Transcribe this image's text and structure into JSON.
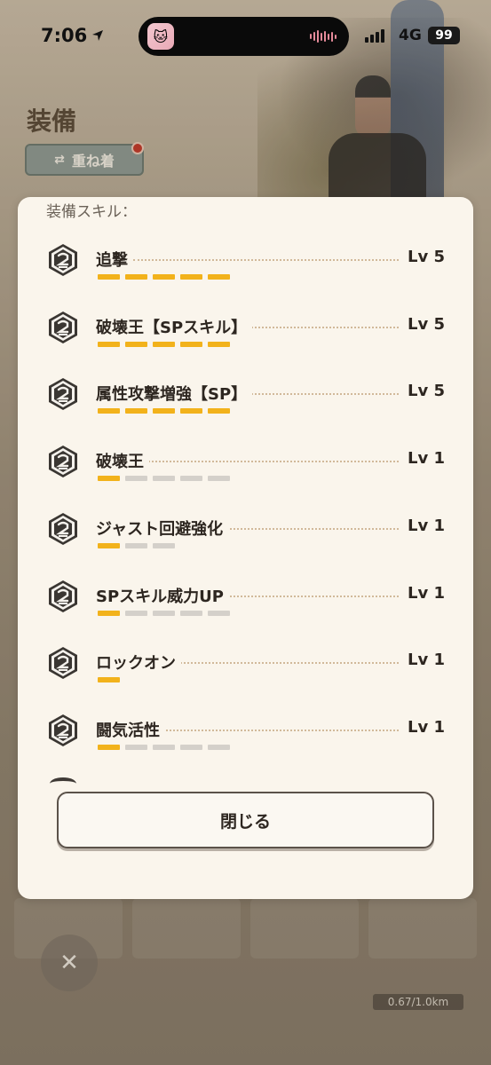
{
  "status_bar": {
    "time": "7:06",
    "network": "4G",
    "battery": "99"
  },
  "background": {
    "page_title": "装備",
    "overlay_button_label": "重ね着",
    "close_icon": "✕",
    "distance": "0.67/1.0km"
  },
  "modal": {
    "heading": "装備スキル：",
    "skills": [
      {
        "name": "追撃",
        "level": "Lv 5",
        "filled": 5,
        "total": 5
      },
      {
        "name": "破壊王【SPスキル】",
        "level": "Lv 5",
        "filled": 5,
        "total": 5
      },
      {
        "name": "属性攻撃増強【SP】",
        "level": "Lv 5",
        "filled": 5,
        "total": 5
      },
      {
        "name": "破壊王",
        "level": "Lv 1",
        "filled": 1,
        "total": 5
      },
      {
        "name": "ジャスト回避強化",
        "level": "Lv 1",
        "filled": 1,
        "total": 3
      },
      {
        "name": "SPスキル威力UP",
        "level": "Lv 1",
        "filled": 1,
        "total": 5
      },
      {
        "name": "ロックオン",
        "level": "Lv 1",
        "filled": 1,
        "total": 1
      },
      {
        "name": "闘気活性",
        "level": "Lv 1",
        "filled": 1,
        "total": 5
      }
    ],
    "close_label": "閉じる"
  },
  "colors": {
    "bar_on": "#f2b21b",
    "bar_off": "#d4d0ca",
    "modal_bg": "#faf5ec"
  },
  "icons": {
    "skill_icon": "skill-emblem-icon",
    "location_arrow": "location-arrow-icon"
  }
}
